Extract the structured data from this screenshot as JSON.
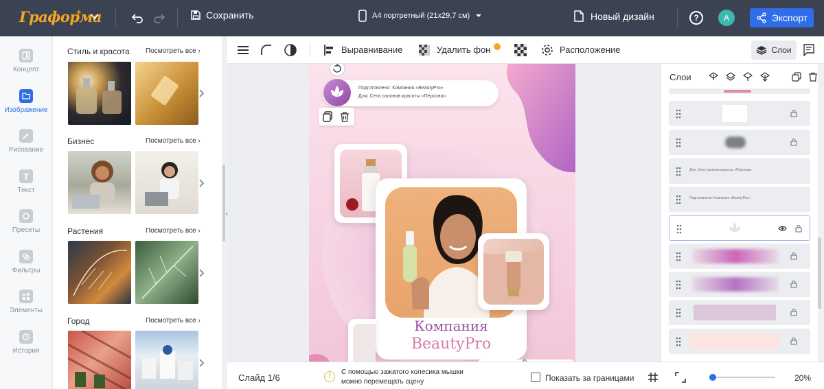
{
  "topbar": {
    "logo": "Граформа",
    "save_label": "Сохранить",
    "format_label": "А4 портретный (21х29,7 см)",
    "new_design_label": "Новый дизайн",
    "avatar_letter": "A",
    "export_label": "Экспорт"
  },
  "rail": {
    "items": [
      {
        "label": "Концепт"
      },
      {
        "label": "Изображение"
      },
      {
        "label": "Рисование"
      },
      {
        "label": "Текст"
      },
      {
        "label": "Пресеты"
      },
      {
        "label": "Фильтры"
      },
      {
        "label": "Элементы"
      },
      {
        "label": "История"
      }
    ],
    "active_index": 1
  },
  "library": {
    "see_all_label": "Посмотреть все",
    "categories": [
      {
        "title": "Стиль и красота"
      },
      {
        "title": "Бизнес"
      },
      {
        "title": "Растения"
      },
      {
        "title": "Город"
      }
    ]
  },
  "canvas_toolbar": {
    "align_label": "Выравнивание",
    "remove_bg_label": "Удалить фон",
    "arrange_label": "Расположение",
    "layers_label": "Слои"
  },
  "design": {
    "prepared_line": "Подготовлено: Компания «BeautyPro»",
    "for_line": "Для: Сети салонов красоты «Персона»",
    "company_word": "Компания",
    "brand_word": "BeautyPro"
  },
  "layers_panel": {
    "title": "Слои",
    "rows": [
      {
        "label": ""
      },
      {
        "label": ""
      },
      {
        "label": "Для: Сети салонов красоты «Персона»"
      },
      {
        "label": "Подготовлено: Компания «BeautyPro»"
      },
      {
        "label": ""
      },
      {
        "label": ""
      },
      {
        "label": ""
      },
      {
        "label": ""
      },
      {
        "label": ""
      }
    ]
  },
  "bottombar": {
    "slide_label": "Слайд 1/6",
    "hint_text": "С помощью зажатого колесика мышки можно перемещать сцену",
    "show_outside_label": "Показать за границами",
    "zoom_value": 0.05,
    "zoom_label": "20%"
  },
  "colors": {
    "topbar_bg": "#3b4252",
    "accent": "#2f6ee8",
    "logo": "#f6a623",
    "brand_purple": "#9b4f9e",
    "brand_pink": "#d77aa8"
  }
}
